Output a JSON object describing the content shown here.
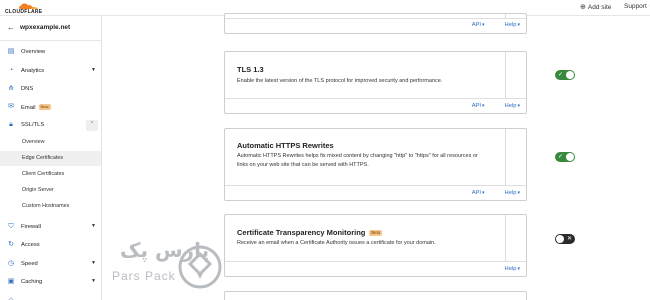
{
  "header": {
    "logo_text": "CLOUDFLARE",
    "add_site_label": "Add site",
    "support_label": "Support"
  },
  "sidebar": {
    "site_name": "wpxexample.net",
    "items": [
      {
        "label": "Overview",
        "icon": "document-icon"
      },
      {
        "label": "Analytics",
        "icon": "chart-icon"
      },
      {
        "label": "DNS",
        "icon": "network-icon"
      },
      {
        "label": "Email",
        "icon": "email-icon",
        "badge": "New"
      },
      {
        "label": "SSL/TLS",
        "icon": "lock-icon"
      },
      {
        "label": "Overview"
      },
      {
        "label": "Edge Certificates"
      },
      {
        "label": "Client Certificates"
      },
      {
        "label": "Origin Server"
      },
      {
        "label": "Custom Hostnames"
      },
      {
        "label": "Firewall",
        "icon": "shield-icon"
      },
      {
        "label": "Access",
        "icon": "access-icon"
      },
      {
        "label": "Speed",
        "icon": "speed-icon"
      },
      {
        "label": "Caching",
        "icon": "caching-icon"
      }
    ]
  },
  "cards": [
    {
      "links": {
        "api": "API",
        "help": "Help"
      }
    },
    {
      "title": "TLS 1.3",
      "description": "Enable the latest version of the TLS protocol for improved security and performance.",
      "toggle": "on",
      "links": {
        "api": "API",
        "help": "Help"
      }
    },
    {
      "title": "Automatic HTTPS Rewrites",
      "description": "Automatic HTTPS Rewrites helps fix mixed content by changing \"http\" to \"https\" for all resources or links on your web site that can be served with HTTPS.",
      "toggle": "on",
      "links": {
        "api": "API",
        "help": "Help"
      }
    },
    {
      "title": "Certificate Transparency Monitoring",
      "badge": "Beta",
      "description": "Receive an email when a Certificate Authority issues a certificate for your domain.",
      "toggle": "off",
      "links": {
        "help": "Help"
      }
    }
  ],
  "watermark": {
    "fa": "پارس پک",
    "en": "Pars Pack"
  },
  "colors": {
    "accent": "#2f6dc4",
    "toggle_on": "#3a8a3e",
    "toggle_off": "#2b2b2b",
    "badge": "#f6c58a"
  }
}
